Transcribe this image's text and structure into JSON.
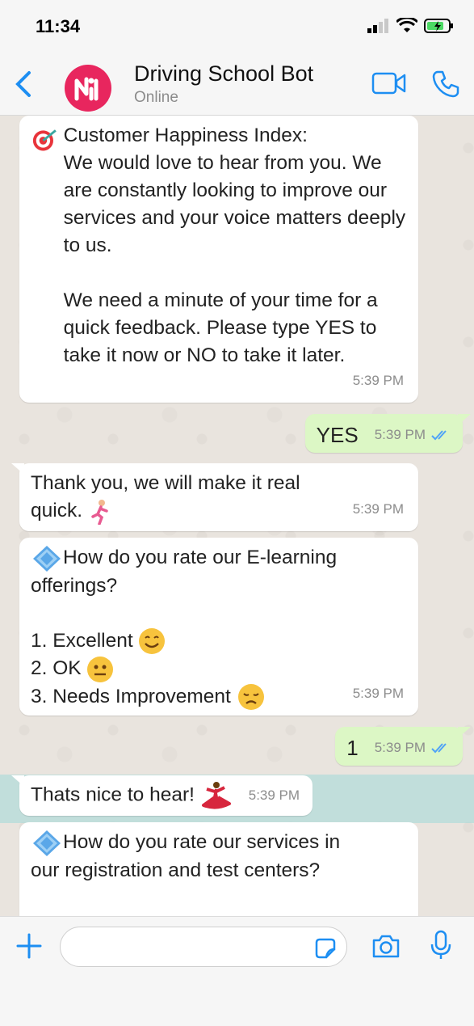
{
  "status_bar": {
    "time": "11:34"
  },
  "header": {
    "title": "Driving School Bot",
    "subtitle": "Online"
  },
  "messages": [
    {
      "direction": "in",
      "text": "Customer Happiness Index:\nWe would love to hear from you. We are constantly looking to improve our services and your voice matters deeply to us.\n\nWe need a minute of your time for a quick feedback. Please type YES to take it now or NO to take it later.",
      "time": "5:39 PM"
    },
    {
      "direction": "out",
      "text": "YES",
      "time": "5:39 PM"
    },
    {
      "direction": "in",
      "text": "Thank you, we will make it real quick.",
      "time": "5:39 PM"
    },
    {
      "direction": "in",
      "text": "How do you rate our E-learning offerings?\n\n1. Excellent\n2. OK\n3. Needs Improvement",
      "lines": [
        "How do you rate our E-learning",
        "offerings?",
        "1. Excellent",
        "2. OK",
        "3. Needs Improvement"
      ],
      "time": "5:39 PM"
    },
    {
      "direction": "out",
      "text": "1",
      "time": "5:39 PM"
    },
    {
      "direction": "in",
      "text": "Thats nice to hear!",
      "time": "5:39 PM"
    },
    {
      "direction": "in",
      "text": "How do you rate our services in our registration and test centers?",
      "lines": [
        "How do you rate our services in",
        "our registration and test centers?"
      ],
      "time": ""
    }
  ],
  "colors": {
    "accent": "#1d8ef2",
    "incoming_bubble": "#ffffff",
    "outgoing_bubble": "#dcf7c5",
    "avatar": "#e8265e",
    "highlight": "#a0d8d8"
  },
  "icons": {
    "back": "chevron-left-icon",
    "video": "video-camera-icon",
    "call": "phone-icon",
    "plus": "plus-icon",
    "sticker": "sticker-icon",
    "camera": "camera-icon",
    "mic": "microphone-icon"
  }
}
